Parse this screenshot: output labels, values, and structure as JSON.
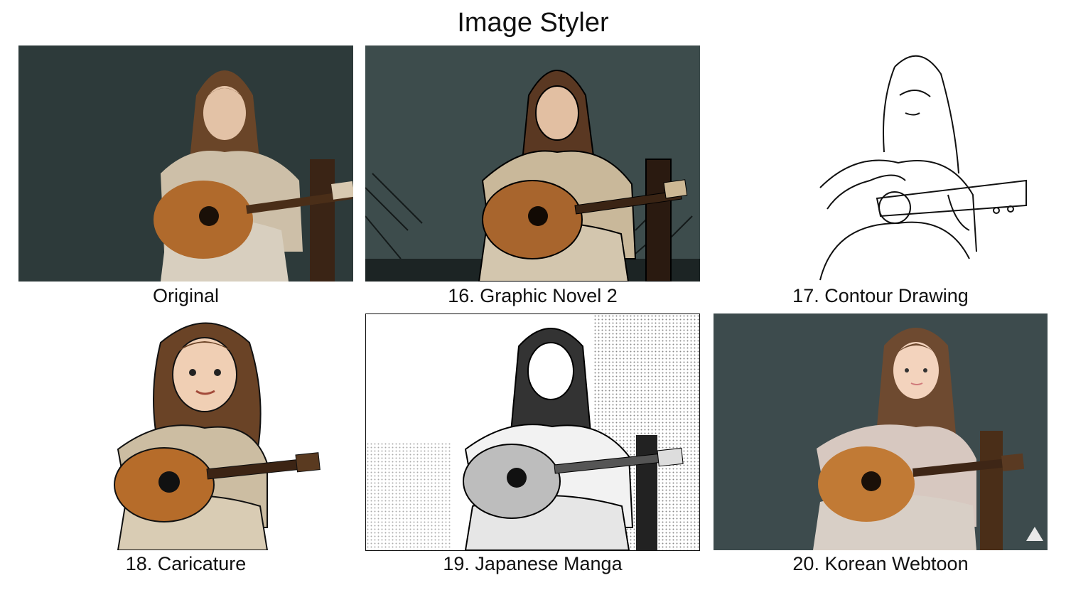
{
  "app": {
    "title": "Image Styler"
  },
  "panels": [
    {
      "caption": "Original"
    },
    {
      "caption": "16. Graphic Novel 2"
    },
    {
      "caption": "17. Contour Drawing"
    },
    {
      "caption": "18. Caricature"
    },
    {
      "caption": "19. Japanese Manga"
    },
    {
      "caption": "20. Korean Webtoon"
    }
  ],
  "colors": {
    "background": "#ffffff",
    "text": "#111111",
    "studio_backdrop": "#2e3a3a",
    "guitar_wood": "#b06a2c",
    "hair_brown": "#5a3a22",
    "sweater_beige": "#cdbfa8"
  }
}
